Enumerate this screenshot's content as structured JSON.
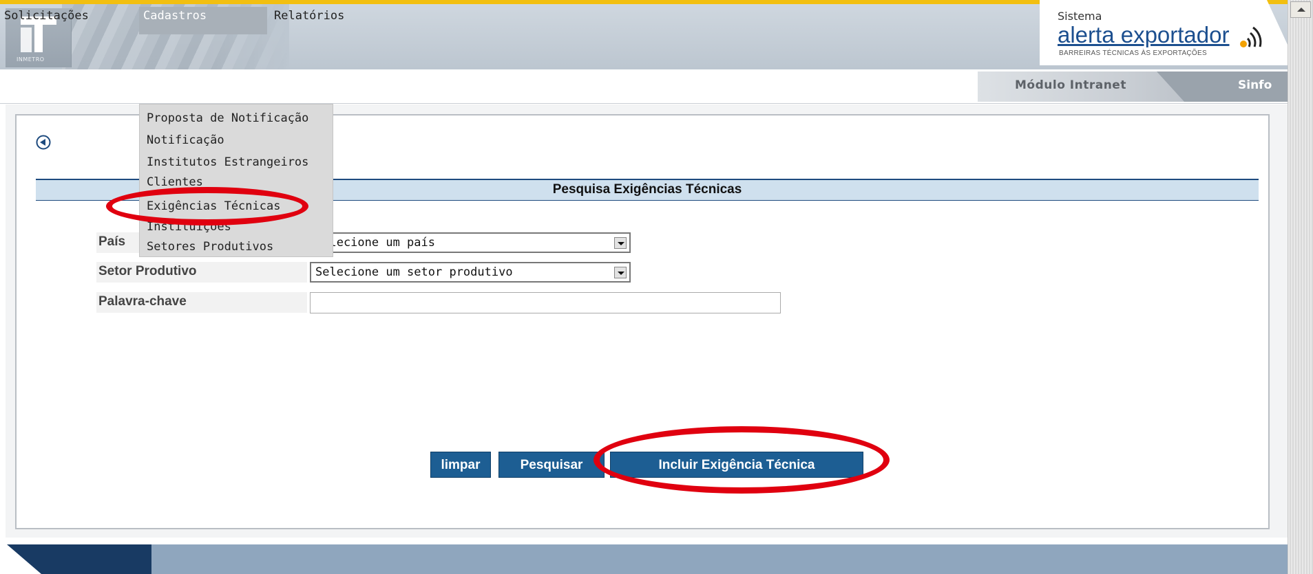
{
  "header": {
    "logo_text": "INMETRO",
    "brand_sistema": "Sistema",
    "brand_name": "alerta exportador",
    "brand_subtitle": "BARREIRAS TÉCNICAS ÀS EXPORTAÇÕES"
  },
  "menu": {
    "items": [
      {
        "label": "Solicitações"
      },
      {
        "label": "Cadastros"
      },
      {
        "label": "Relatórios"
      }
    ],
    "modulo": "Módulo Intranet",
    "sinfo": "Sinfo"
  },
  "dropdown": {
    "items": [
      {
        "label": "Proposta de Notificação"
      },
      {
        "label": "Notificação"
      },
      {
        "label": "Institutos Estrangeiros"
      },
      {
        "label": "Clientes"
      },
      {
        "label": "Exigências Técnicas"
      },
      {
        "label": "Instituições"
      },
      {
        "label": "Setores Produtivos"
      }
    ]
  },
  "form": {
    "title": "Pesquisa Exigências Técnicas",
    "pais_label": "País",
    "pais_value": "Selecione um país",
    "setor_label": "Setor Produtivo",
    "setor_value": "Selecione um setor produtivo",
    "palavra_label": "Palavra-chave",
    "palavra_value": ""
  },
  "buttons": {
    "limpar": "limpar",
    "pesquisar": "Pesquisar",
    "incluir": "Incluir Exigência Técnica"
  },
  "colors": {
    "accent_yellow": "#f2bf10",
    "button_blue": "#1d5e93",
    "annotation_red": "#e0000f"
  }
}
